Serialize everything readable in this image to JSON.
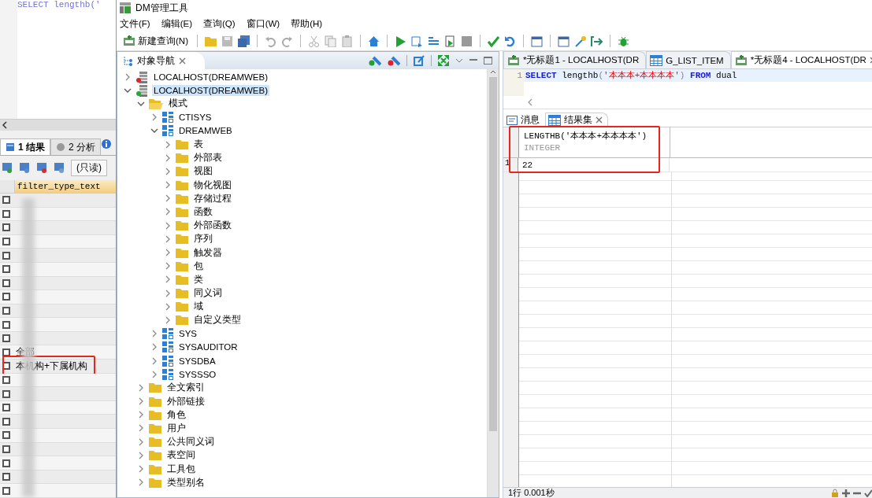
{
  "background_window": {
    "code_line": "SELECT lengthb('",
    "result_tabs": [
      {
        "label": "1 结果",
        "selected": true
      },
      {
        "label": "2 分析",
        "selected": false
      }
    ],
    "readonly_label": "(只读)",
    "column": "filter_type_text",
    "rows": [
      {
        "checked": false,
        "boxed": false
      },
      {
        "checked": false,
        "boxed": false
      },
      {
        "checked": false,
        "boxed": false
      },
      {
        "checked": false,
        "boxed": false
      },
      {
        "checked": false,
        "boxed": false
      },
      {
        "checked": false,
        "boxed": false
      },
      {
        "checked": false,
        "boxed": false
      },
      {
        "checked": false,
        "boxed": false
      },
      {
        "checked": false,
        "boxed": false
      },
      {
        "checked": false,
        "boxed": false
      },
      {
        "checked": false,
        "boxed": false
      },
      {
        "text": "全部",
        "checked": false,
        "boxed": false
      },
      {
        "text": "本机构+下属机构",
        "checked": false,
        "boxed": true
      },
      {
        "checked": false,
        "boxed": false
      },
      {
        "checked": false,
        "boxed": false
      },
      {
        "checked": false,
        "boxed": false
      },
      {
        "checked": false,
        "boxed": false
      },
      {
        "checked": false,
        "boxed": false
      },
      {
        "checked": false,
        "boxed": false
      },
      {
        "checked": false,
        "boxed": false
      },
      {
        "checked": false,
        "boxed": false
      },
      {
        "checked": false,
        "boxed": false
      }
    ]
  },
  "window": {
    "title": "DM管理工具"
  },
  "menu": [
    "文件(F)",
    "编辑(E)",
    "查询(Q)",
    "窗口(W)",
    "帮助(H)"
  ],
  "toolbar": {
    "new_query": "新建查询(N)"
  },
  "navigator": {
    "title": "对象导航",
    "tree": [
      {
        "label": "LOCALHOST(DREAMWEB)",
        "kind": "server",
        "connected": false,
        "expanded": false,
        "selected": false
      },
      {
        "label": "LOCALHOST(DREAMWEB)",
        "kind": "server",
        "connected": true,
        "expanded": true,
        "selected": true,
        "children": [
          {
            "label": "模式",
            "kind": "folder",
            "expanded": true,
            "selected": false,
            "children": [
              {
                "label": "CTISYS",
                "kind": "schema",
                "expanded": false,
                "selected": false
              },
              {
                "label": "DREAMWEB",
                "kind": "schema",
                "expanded": true,
                "selected": false,
                "children": [
                  {
                    "label": "表",
                    "kind": "folder",
                    "expanded": false,
                    "selected": false
                  },
                  {
                    "label": "外部表",
                    "kind": "folder",
                    "expanded": false,
                    "selected": false
                  },
                  {
                    "label": "视图",
                    "kind": "folder",
                    "expanded": false,
                    "selected": false
                  },
                  {
                    "label": "物化视图",
                    "kind": "folder",
                    "expanded": false,
                    "selected": false
                  },
                  {
                    "label": "存储过程",
                    "kind": "folder",
                    "expanded": false,
                    "selected": false
                  },
                  {
                    "label": "函数",
                    "kind": "folder",
                    "expanded": false,
                    "selected": false
                  },
                  {
                    "label": "外部函数",
                    "kind": "folder",
                    "expanded": false,
                    "selected": false
                  },
                  {
                    "label": "序列",
                    "kind": "folder",
                    "expanded": false,
                    "selected": false
                  },
                  {
                    "label": "触发器",
                    "kind": "folder",
                    "expanded": false,
                    "selected": false
                  },
                  {
                    "label": "包",
                    "kind": "folder",
                    "expanded": false,
                    "selected": false
                  },
                  {
                    "label": "类",
                    "kind": "folder",
                    "expanded": false,
                    "selected": false
                  },
                  {
                    "label": "同义词",
                    "kind": "folder",
                    "expanded": false,
                    "selected": false
                  },
                  {
                    "label": "域",
                    "kind": "folder",
                    "expanded": false,
                    "selected": false
                  },
                  {
                    "label": "自定义类型",
                    "kind": "folder",
                    "expanded": false,
                    "selected": false
                  }
                ]
              },
              {
                "label": "SYS",
                "kind": "schema",
                "expanded": false,
                "selected": false
              },
              {
                "label": "SYSAUDITOR",
                "kind": "schema",
                "expanded": false,
                "selected": false
              },
              {
                "label": "SYSDBA",
                "kind": "schema",
                "expanded": false,
                "selected": false
              },
              {
                "label": "SYSSSO",
                "kind": "schema",
                "expanded": false,
                "selected": false
              }
            ]
          },
          {
            "label": "全文索引",
            "kind": "folder",
            "expanded": false,
            "selected": false
          },
          {
            "label": "外部链接",
            "kind": "folder",
            "expanded": false,
            "selected": false
          },
          {
            "label": "角色",
            "kind": "folder",
            "expanded": false,
            "selected": false
          },
          {
            "label": "用户",
            "kind": "folder",
            "expanded": false,
            "selected": false
          },
          {
            "label": "公共同义词",
            "kind": "folder",
            "expanded": false,
            "selected": false
          },
          {
            "label": "表空间",
            "kind": "folder",
            "expanded": false,
            "selected": false
          },
          {
            "label": "工具包",
            "kind": "folder",
            "expanded": false,
            "selected": false
          },
          {
            "label": "类型别名",
            "kind": "folder",
            "expanded": false,
            "selected": false
          }
        ]
      }
    ]
  },
  "editor_tabs": [
    {
      "label": "*无标题1 - LOCALHOST(DR",
      "kind": "sql",
      "selected": false
    },
    {
      "label": "G_LIST_ITEM",
      "kind": "table",
      "selected": false
    },
    {
      "label": "*无标题4 - LOCALHOST(DR",
      "kind": "sql",
      "selected": true
    }
  ],
  "editor": {
    "line_number": "1",
    "tokens": [
      {
        "text": "SELECT",
        "kind": "keyword"
      },
      {
        "text": " lengthb",
        "kind": "plain"
      },
      {
        "text": "(",
        "kind": "punct"
      },
      {
        "text": "'本本本+本本本本'",
        "kind": "string"
      },
      {
        "text": ")",
        "kind": "punct"
      },
      {
        "text": " FROM",
        "kind": "keyword"
      },
      {
        "text": " dual",
        "kind": "plain"
      }
    ]
  },
  "result_tabs": [
    {
      "label": "消息",
      "kind": "message",
      "selected": false
    },
    {
      "label": "结果集",
      "kind": "grid",
      "selected": true
    }
  ],
  "result": {
    "boxed": true,
    "columns": [
      {
        "name": "LENGTHB('本本本+本本本本')",
        "type": "INTEGER"
      }
    ],
    "rows": [
      {
        "number": "1",
        "cells": [
          "22"
        ]
      }
    ]
  },
  "status_bar": "1行 0.001秒"
}
